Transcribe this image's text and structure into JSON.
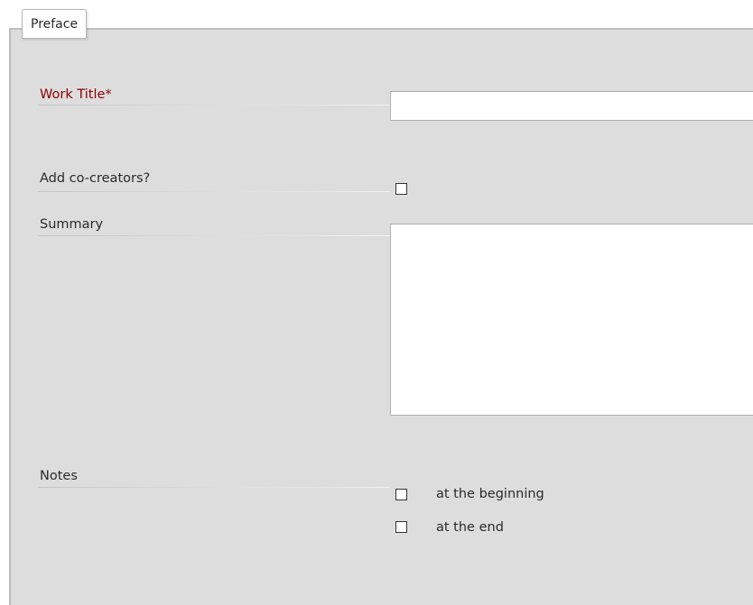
{
  "fieldset": {
    "legend": "Preface"
  },
  "work_title": {
    "label": "Work Title*",
    "value": ""
  },
  "co_creators": {
    "label": "Add co-creators?",
    "checked": false
  },
  "summary": {
    "label": "Summary",
    "value": ""
  },
  "notes": {
    "label": "Notes",
    "options": [
      {
        "label": "at the beginning",
        "checked": false
      },
      {
        "label": "at the end",
        "checked": false
      }
    ]
  },
  "colors": {
    "required_label": "#900000",
    "panel_background": "#dddddd"
  }
}
